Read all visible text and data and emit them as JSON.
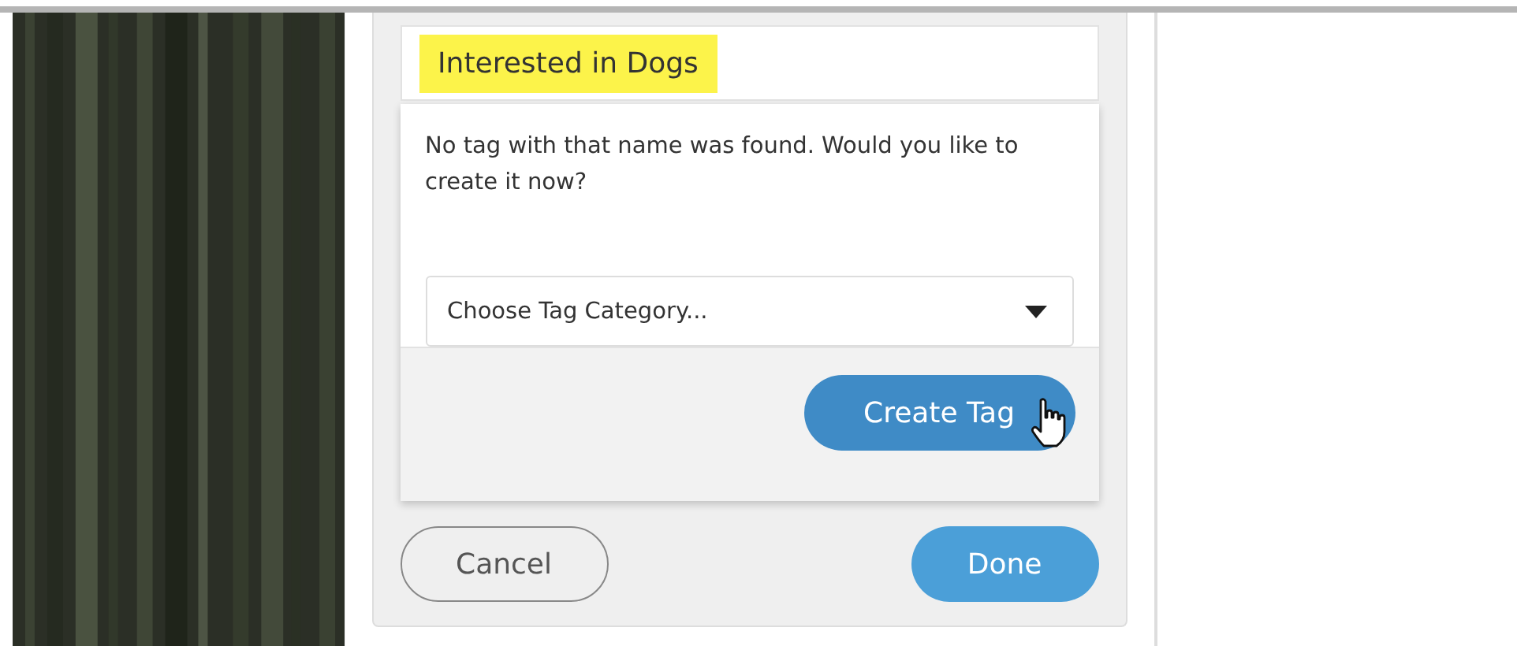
{
  "tag_field": {
    "value": "Interested in Dogs",
    "highlighted": true
  },
  "create_popup": {
    "message": "No tag with that name was found. Would you like to create it now?",
    "category_select": {
      "placeholder": "Choose Tag Category..."
    },
    "create_button": {
      "label": "Create Tag",
      "hovered": true
    }
  },
  "buttons": [
    {
      "label": "Cancel",
      "kind": "secondary"
    },
    {
      "label": "Done",
      "kind": "primary"
    }
  ]
}
